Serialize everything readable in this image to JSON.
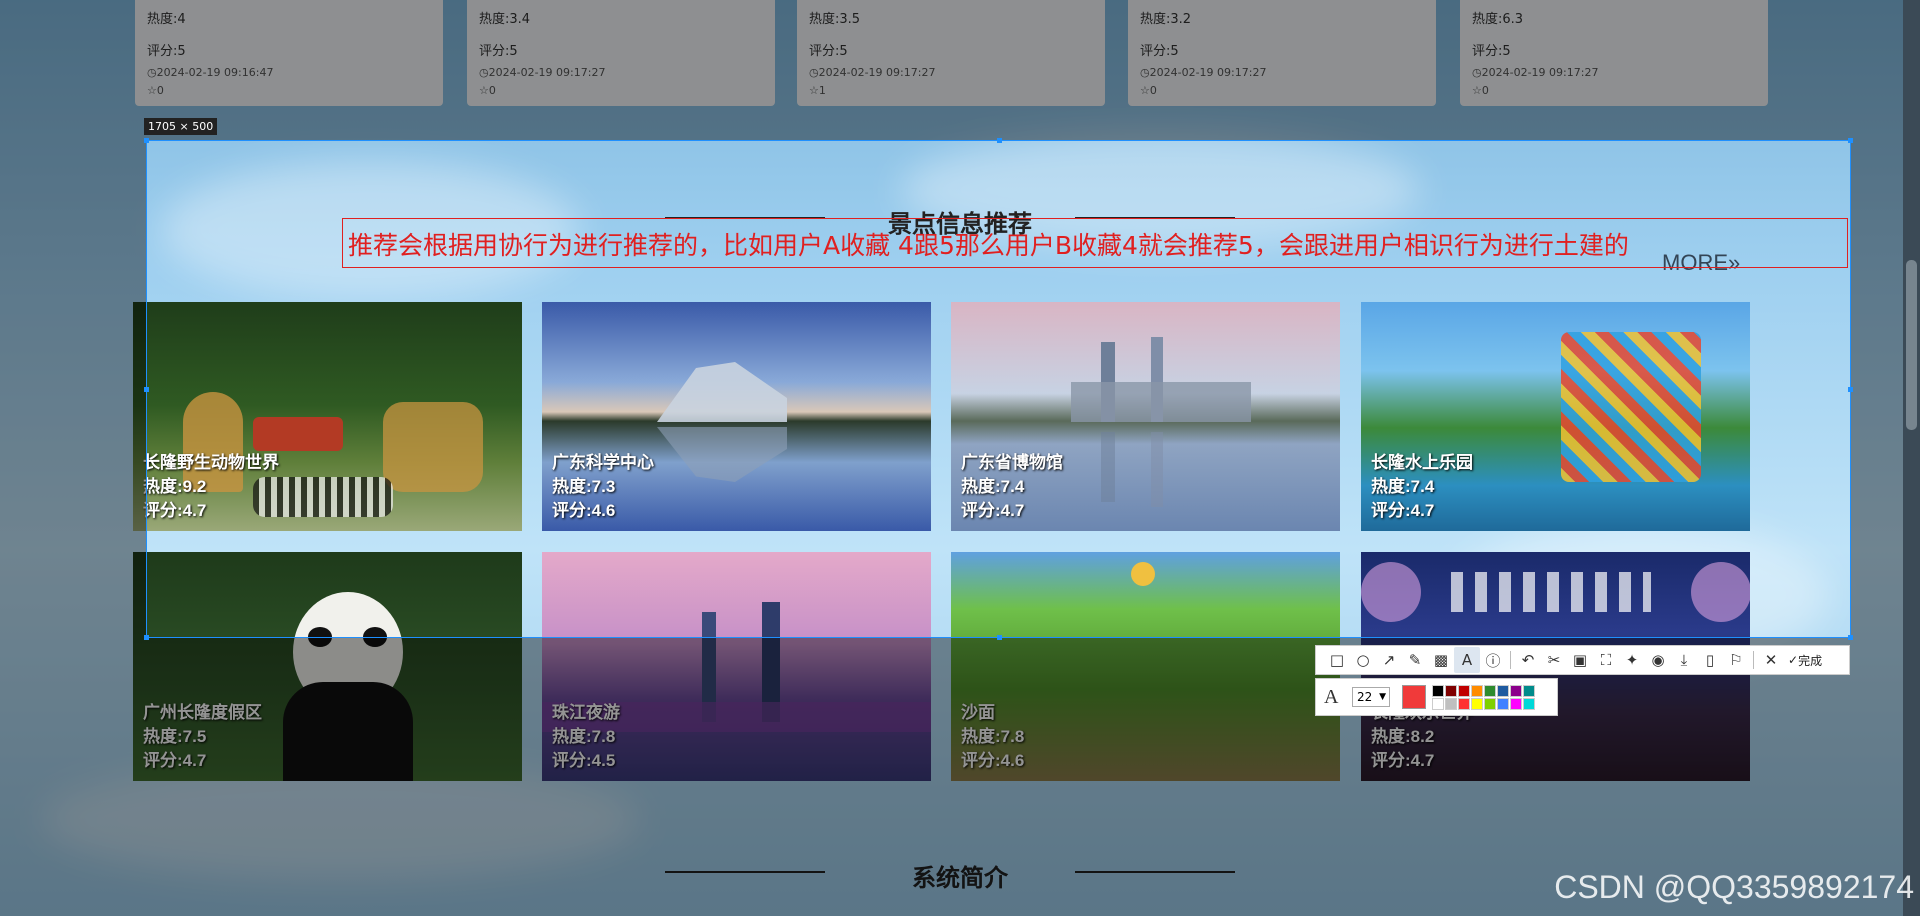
{
  "top_cards": [
    {
      "heat": "热度:4",
      "score": "评分:5",
      "time": "2024-02-19 09:16:47",
      "fav": "0"
    },
    {
      "heat": "热度:3.4",
      "score": "评分:5",
      "time": "2024-02-19 09:17:27",
      "fav": "0"
    },
    {
      "heat": "热度:3.5",
      "score": "评分:5",
      "time": "2024-02-19 09:17:27",
      "fav": "1"
    },
    {
      "heat": "热度:3.2",
      "score": "评分:5",
      "time": "2024-02-19 09:17:27",
      "fav": "0"
    },
    {
      "heat": "热度:6.3",
      "score": "评分:5",
      "time": "2024-02-19 09:17:27",
      "fav": "0"
    }
  ],
  "selection": {
    "size_label": "1705 × 500"
  },
  "annotation": {
    "text": "推荐会根据用协行为进行推荐的，比如用户A收藏 4跟5那么用户B收藏4就会推荐5，会跟进用户相识行为进行土建的"
  },
  "recommend": {
    "title": "景点信息推荐",
    "more": "MORE»",
    "items": [
      {
        "name": "长隆野生动物世界",
        "heat": "热度:9.2",
        "score": "评分:4.7"
      },
      {
        "name": "广东科学中心",
        "heat": "热度:7.3",
        "score": "评分:4.6"
      },
      {
        "name": "广东省博物馆",
        "heat": "热度:7.4",
        "score": "评分:4.7"
      },
      {
        "name": "长隆水上乐园",
        "heat": "热度:7.4",
        "score": "评分:4.7"
      },
      {
        "name": "广州长隆度假区",
        "heat": "热度:7.5",
        "score": "评分:4.7"
      },
      {
        "name": "珠江夜游",
        "heat": "热度:7.8",
        "score": "评分:4.5"
      },
      {
        "name": "沙面",
        "heat": "热度:7.8",
        "score": "评分:4.6"
      },
      {
        "name": "长隆欢乐世界",
        "heat": "热度:8.2",
        "score": "评分:4.7"
      }
    ]
  },
  "toolbar": {
    "done_label": "完成",
    "font_size": "22",
    "current_color": "#f03a3a",
    "palette": [
      "#000000",
      "#7f0000",
      "#c00000",
      "#ff8c00",
      "#2e8b2e",
      "#1e5aa0",
      "#8b008b",
      "#008b8b",
      "#ffffff",
      "#bfbfbf",
      "#ff3030",
      "#ffff00",
      "#7fd000",
      "#4080ff",
      "#ff00ff",
      "#00d8d8"
    ]
  },
  "system": {
    "title": "系统简介"
  },
  "watermark": "CSDN @QQ3359892174"
}
